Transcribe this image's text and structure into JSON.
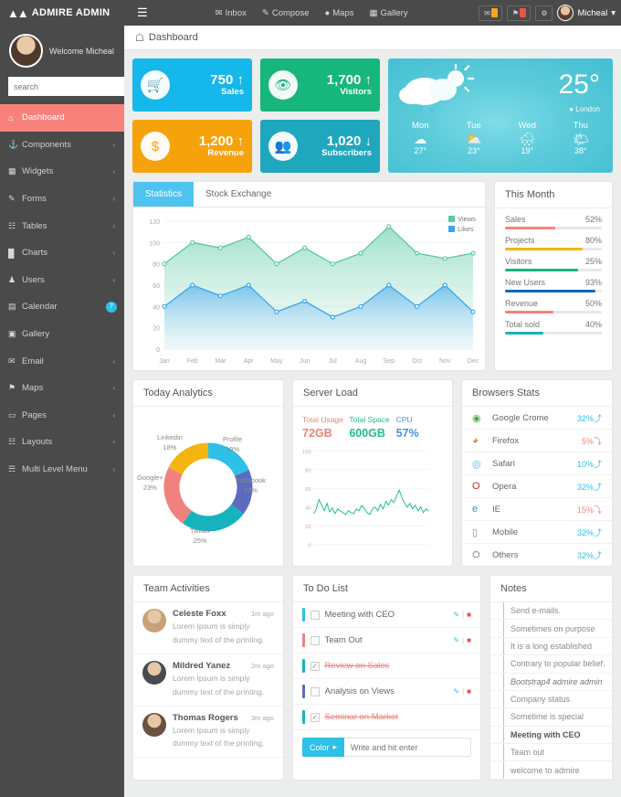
{
  "topbar": {
    "brand": "ADMIRE ADMIN",
    "menu_icon": "hamburger-icon",
    "nav": [
      {
        "label": "Inbox",
        "icon": "inbox-icon"
      },
      {
        "label": "Compose",
        "icon": "compose-icon"
      },
      {
        "label": "Maps",
        "icon": "map-pin-icon"
      },
      {
        "label": "Gallery",
        "icon": "gallery-icon"
      }
    ],
    "icons": [
      {
        "name": "mail-icon",
        "glyph": "✉",
        "badge_color": "#f5a623"
      },
      {
        "name": "bell-icon",
        "glyph": "⚑",
        "badge_color": "#f0514b"
      },
      {
        "name": "gear-icon",
        "glyph": "⚙",
        "badge_color": ""
      }
    ],
    "user": "Micheal",
    "user_caret": "▾"
  },
  "sidebar": {
    "welcome": "Welcome Micheal",
    "search_placeholder": "search",
    "search_icon": "search-icon",
    "items": [
      {
        "label": "Dashboard",
        "icon": "",
        "glyph": "⌂",
        "active": true,
        "chevron": false
      },
      {
        "label": "Components",
        "icon": "anchor",
        "glyph": "⚓",
        "active": false,
        "chevron": true
      },
      {
        "label": "Widgets",
        "icon": "grid",
        "glyph": "▦",
        "active": false,
        "chevron": true
      },
      {
        "label": "Forms",
        "icon": "pencil",
        "glyph": "✎",
        "active": false,
        "chevron": true
      },
      {
        "label": "Tables",
        "icon": "table",
        "glyph": "☷",
        "active": false,
        "chevron": true
      },
      {
        "label": "Charts",
        "icon": "bar-chart",
        "glyph": "█",
        "active": false,
        "chevron": true
      },
      {
        "label": "Users",
        "icon": "user",
        "glyph": "♟",
        "active": false,
        "chevron": true
      },
      {
        "label": "Calendar",
        "icon": "calendar",
        "glyph": "▤",
        "active": false,
        "chevron": false,
        "badge": "7"
      },
      {
        "label": "Gallery",
        "icon": "image",
        "glyph": "▣",
        "active": false,
        "chevron": false
      },
      {
        "label": "Email",
        "icon": "envelope",
        "glyph": "✉",
        "active": false,
        "chevron": true
      },
      {
        "label": "Maps",
        "icon": "map-pin",
        "glyph": "⚑",
        "active": false,
        "chevron": true
      },
      {
        "label": "Pages",
        "icon": "file",
        "glyph": "▭",
        "active": false,
        "chevron": true
      },
      {
        "label": "Layouts",
        "icon": "layout",
        "glyph": "☷",
        "active": false,
        "chevron": true
      },
      {
        "label": "Multi Level Menu",
        "icon": "sitemap",
        "glyph": "☴",
        "active": false,
        "chevron": true
      }
    ]
  },
  "breadcrumb": {
    "icon": "home-icon",
    "label": "Dashboard"
  },
  "kpis": [
    {
      "value": "750",
      "arrow": "↑",
      "label": "Sales",
      "icon": "cart-icon",
      "glyph": "🛒",
      "color": "#16b7ea"
    },
    {
      "value": "1,700",
      "arrow": "↑",
      "label": "Visitors",
      "icon": "eye-icon",
      "glyph": "👁",
      "color": "#17b67c"
    },
    {
      "value": "1,200",
      "arrow": "↑",
      "label": "Revenue",
      "icon": "dollar-icon",
      "glyph": "$",
      "color": "#f5a20b"
    },
    {
      "value": "1,020",
      "arrow": "↓",
      "label": "Subscribers",
      "icon": "users-icon",
      "glyph": "👥",
      "color": "#1fa7bd"
    }
  ],
  "weather": {
    "main_icon": "rain-cloud-sun-icon",
    "temperature": "25°",
    "location": "London",
    "location_icon": "pin-icon",
    "days": [
      {
        "name": "Mon",
        "icon": "cloud-icon",
        "glyph": "☁",
        "temp": "27°"
      },
      {
        "name": "Tue",
        "icon": "cloud-sun-icon",
        "glyph": "⛅",
        "temp": "23°"
      },
      {
        "name": "Wed",
        "icon": "cloud-rain-icon",
        "glyph": "🌧",
        "temp": "19°"
      },
      {
        "name": "Thu",
        "icon": "sun-cloud-icon",
        "glyph": "🌤",
        "temp": "38°"
      }
    ]
  },
  "statistics": {
    "tabs": [
      {
        "label": "Statistics",
        "active": true
      },
      {
        "label": "Stock Exchange",
        "active": false
      }
    ]
  },
  "this_month": {
    "title": "This Month",
    "items": [
      {
        "label": "Sales",
        "percent": "52%",
        "bar": 52,
        "color": "#f9817c"
      },
      {
        "label": "Projects",
        "percent": "80%",
        "bar": 80,
        "color": "#f5b511"
      },
      {
        "label": "Visitors",
        "percent": "25%",
        "bar": 75,
        "color": "#17b67c"
      },
      {
        "label": "New Users",
        "percent": "93%",
        "bar": 93,
        "color": "#1266c0"
      },
      {
        "label": "Revenue",
        "percent": "50%",
        "bar": 50,
        "color": "#f9817c"
      },
      {
        "label": "Total sold",
        "percent": "40%",
        "bar": 40,
        "color": "#17b3bd"
      }
    ]
  },
  "today_analytics": {
    "title": "Today Analytics"
  },
  "server_load": {
    "title": "Server Load",
    "stats": [
      {
        "label": "Total Usage",
        "value": "72GB",
        "color": "#f0827d"
      },
      {
        "label": "Total Space",
        "value": "600GB",
        "color": "#1fc08a"
      },
      {
        "label": "CPU",
        "value": "57%",
        "color": "#4a90e2"
      }
    ]
  },
  "browsers": {
    "title": "Browsers Stats",
    "rows": [
      {
        "name": "Google Crome",
        "icon": "chrome-icon",
        "glyph": "◉",
        "color": "#4caf50",
        "percent": "32%",
        "arrow": "⤴",
        "up": true
      },
      {
        "name": "Firefox",
        "icon": "firefox-icon",
        "glyph": "◕",
        "color": "#e8871a",
        "percent": "5%",
        "arrow": "⤵",
        "up": false
      },
      {
        "name": "Safari",
        "icon": "safari-icon",
        "glyph": "◎",
        "color": "#2ec0e6",
        "percent": "10%",
        "arrow": "⤴",
        "up": true
      },
      {
        "name": "Opera",
        "icon": "opera-icon",
        "glyph": "O",
        "color": "#e2231a",
        "percent": "32%",
        "arrow": "⤴",
        "up": true
      },
      {
        "name": "IE",
        "icon": "internet-explorer-icon",
        "glyph": "e",
        "color": "#2a9fd6",
        "percent": "15%",
        "arrow": "⤵",
        "up": false
      },
      {
        "name": "Mobile",
        "icon": "mobile-icon",
        "glyph": "▯",
        "color": "#8c8c8c",
        "percent": "32%",
        "arrow": "⤴",
        "up": true
      },
      {
        "name": "Others",
        "icon": "others-icon",
        "glyph": "⛭",
        "color": "#8c8c8c",
        "percent": "32%",
        "arrow": "⤴",
        "up": true
      }
    ]
  },
  "team_activities": {
    "title": "Team Activities",
    "rows": [
      {
        "name": "Celeste Foxx",
        "time": "1m ago",
        "text": "Lorem Ipsum is simply dummy text of the printing.",
        "avatar_color": "#c9a178"
      },
      {
        "name": "Mildred Yanez",
        "time": "2m ago",
        "text": "Lorem Ipsum is simply dummy text of the printing.",
        "avatar_color": "#4a4a52"
      },
      {
        "name": "Thomas Rogers",
        "time": "3m ago",
        "text": "Lorem Ipsum is simply dummy text of the printing.",
        "avatar_color": "#6b5140"
      }
    ]
  },
  "todo": {
    "title": "To Do List",
    "items": [
      {
        "text": "Meeting with CEO",
        "bar_color": "#2ec0e6",
        "checked": false,
        "done": false,
        "actions": true
      },
      {
        "text": "Team Out",
        "bar_color": "#f0827d",
        "checked": false,
        "done": false,
        "actions": true
      },
      {
        "text": "Review on Sales",
        "bar_color": "#17b3bd",
        "checked": true,
        "done": true,
        "actions": false
      },
      {
        "text": "Analysis on Views",
        "bar_color": "#5c6bc0",
        "checked": false,
        "done": false,
        "actions": true
      },
      {
        "text": "Seminar on Market",
        "bar_color": "#17b3bd",
        "checked": true,
        "done": true,
        "actions": false
      }
    ],
    "color_button": "Color",
    "color_caret": "▸",
    "input_placeholder": "Write and hit enter",
    "edit_icon": "pencil-icon",
    "delete_icon": "trash-icon"
  },
  "notes": {
    "title": "Notes",
    "rows": [
      {
        "text": "Send e-mails.",
        "style": "normal"
      },
      {
        "text": "Sometimes on purpose",
        "style": "normal"
      },
      {
        "text": "It is a long established",
        "style": "normal"
      },
      {
        "text": "Contrary to popular belief.",
        "style": "normal"
      },
      {
        "text": "Bootstrap4 admire admin",
        "style": "italic"
      },
      {
        "text": "Company status",
        "style": "normal"
      },
      {
        "text": "Sometime is special",
        "style": "normal"
      },
      {
        "text": "Meeting with CEO",
        "style": "bold"
      },
      {
        "text": "Team out",
        "style": "normal"
      },
      {
        "text": "welcome to admire",
        "style": "normal"
      }
    ]
  },
  "chart_data": [
    {
      "type": "area",
      "title": "Statistics",
      "categories": [
        "Jan",
        "Feb",
        "Mar",
        "Apr",
        "May",
        "Jun",
        "Jul",
        "Aug",
        "Sep",
        "Oct",
        "Nov",
        "Dec"
      ],
      "series": [
        {
          "name": "Views",
          "values": [
            80,
            100,
            95,
            105,
            80,
            95,
            80,
            90,
            115,
            90,
            85,
            90
          ],
          "color": "#57c9a5"
        },
        {
          "name": "Likes",
          "values": [
            40,
            60,
            50,
            60,
            35,
            45,
            30,
            40,
            60,
            40,
            60,
            35
          ],
          "color": "#3aa7e8"
        }
      ],
      "ylim": [
        0,
        120
      ],
      "yticks": [
        0,
        20,
        40,
        60,
        80,
        100,
        120
      ],
      "xlabel": "",
      "ylabel": "",
      "grid": false,
      "legend": "top-right"
    },
    {
      "type": "pie",
      "title": "Today Analytics",
      "labels": [
        "Profile",
        "Facebook",
        "Twitter",
        "Google+",
        "Linkedin"
      ],
      "values": [
        19,
        17,
        25,
        23,
        18
      ],
      "value_labels": [
        "19%",
        "17%",
        "25%",
        "23%",
        "18%"
      ],
      "colors": [
        "#2ec0e6",
        "#5c6bc0",
        "#17b3bd",
        "#f0827d",
        "#f5b511"
      ],
      "legend": "outside-labels"
    },
    {
      "type": "line",
      "title": "Server Load",
      "ylim": [
        0,
        100
      ],
      "yticks": [
        0,
        20,
        40,
        60,
        80,
        100
      ],
      "color": "#1fc08a",
      "values": [
        33,
        38,
        48,
        42,
        36,
        44,
        35,
        39,
        33,
        38,
        36,
        34,
        32,
        36,
        34,
        33,
        38,
        36,
        42,
        38,
        34,
        32,
        38,
        40,
        36,
        43,
        38,
        46,
        42,
        48,
        45,
        52,
        58,
        50,
        44,
        40,
        44,
        38,
        42,
        36,
        40,
        34,
        38,
        36
      ]
    }
  ]
}
